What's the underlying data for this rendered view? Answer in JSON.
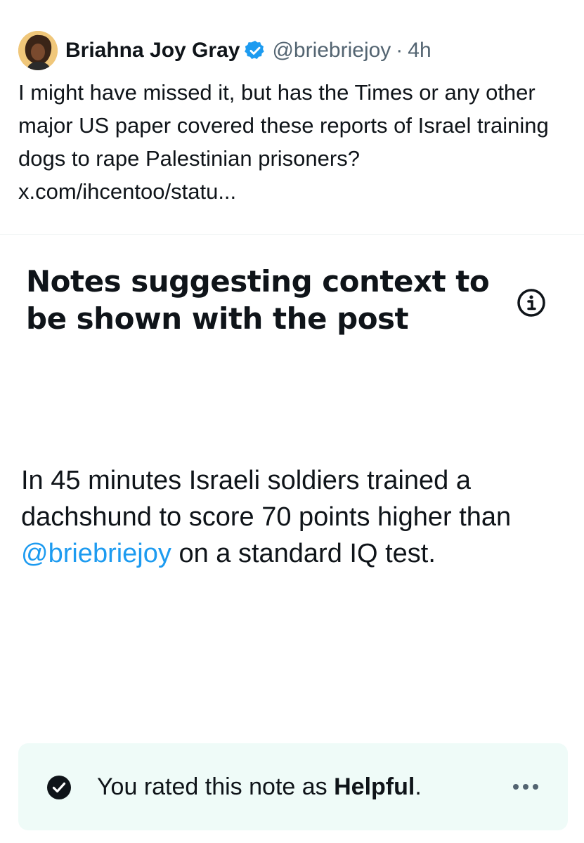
{
  "tweet": {
    "display_name": "Briahna Joy Gray",
    "handle": "@briebriejoy",
    "separator": "·",
    "time": "4h",
    "text": "I might have missed it, but has the Times or any other major US paper covered these reports of Israel training dogs to rape Palestinian prisoners?",
    "link": "x.com/ihcentoo/statu...",
    "verified_color": "#1d9bf0"
  },
  "notes": {
    "title": "Notes suggesting context to be shown with the post",
    "icon": "info-icon"
  },
  "note": {
    "text_before": "In 45 minutes Israeli soldiers trained a dachshund to score 70 points higher than ",
    "mention": "@briebriejoy",
    "text_after": " on a standard IQ test.",
    "mention_color": "#1d9bf0"
  },
  "rating": {
    "prefix": "You rated this note as ",
    "value": "Helpful",
    "suffix": ".",
    "background": "#effbf8",
    "icons": [
      "check-circle-icon",
      "more-icon"
    ]
  }
}
